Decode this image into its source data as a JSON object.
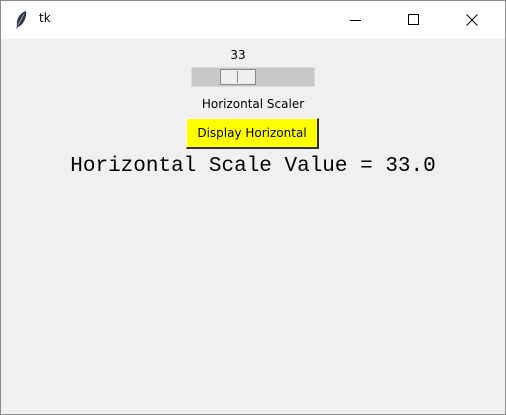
{
  "window": {
    "title": "tk",
    "controls": {
      "minimize_icon": "minimize-icon",
      "maximize_icon": "maximize-icon",
      "close_icon": "close-icon"
    }
  },
  "scale": {
    "value_text": "33",
    "value_fraction": 0.33,
    "label": "Horizontal Scaler"
  },
  "button": {
    "label": "Display Horizontal",
    "color": "#ffff00"
  },
  "result": {
    "text": "Horizontal Scale Value = 33.0"
  },
  "colors": {
    "background": "#f0f0f0",
    "titlebar": "#ffffff"
  }
}
